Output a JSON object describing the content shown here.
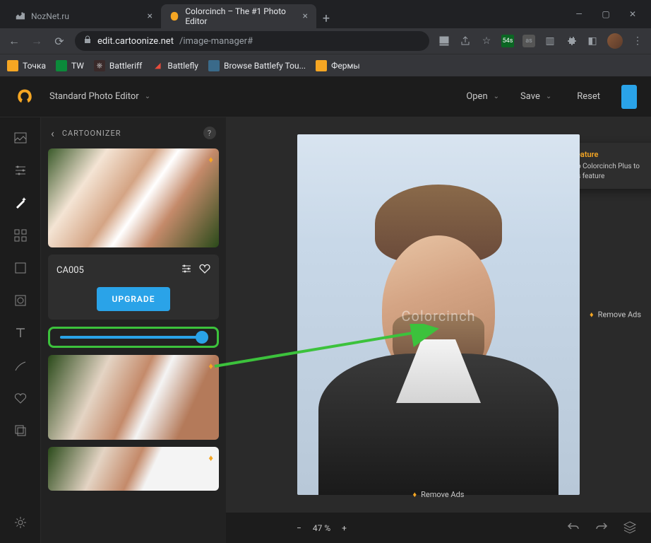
{
  "browser": {
    "tabs": [
      {
        "title": "NozNet.ru",
        "active": false
      },
      {
        "title": "Colorcinch – The #1 Photo Editor",
        "active": true
      }
    ],
    "url_host": "edit.cartoonize.net",
    "url_path": "/image-manager#",
    "badge": "54s",
    "bookmarks": [
      {
        "label": "Точка",
        "color": "#f5a623"
      },
      {
        "label": "TW",
        "color": "#0b8a3a"
      },
      {
        "label": "Battleriff",
        "color": "#8a2a2a"
      },
      {
        "label": "Battlefly",
        "color": "#c0392b"
      },
      {
        "label": "Browse Battlefy Tou...",
        "color": "#3a6a8a"
      },
      {
        "label": "Фермы",
        "color": "#f5a623"
      }
    ]
  },
  "app_header": {
    "title": "Standard Photo Editor",
    "open": "Open",
    "save": "Save",
    "reset": "Reset"
  },
  "panel": {
    "title": "CARTOONIZER",
    "selected_label": "CA005",
    "upgrade": "UPGRADE"
  },
  "tooltip": {
    "title": "Plus Feature",
    "body": "Upgrade to Colorcinch Plus to unlock this feature"
  },
  "canvas": {
    "watermark": "Colorcinch",
    "remove_ads": "Remove Ads"
  },
  "footer": {
    "zoom": "47 %"
  }
}
